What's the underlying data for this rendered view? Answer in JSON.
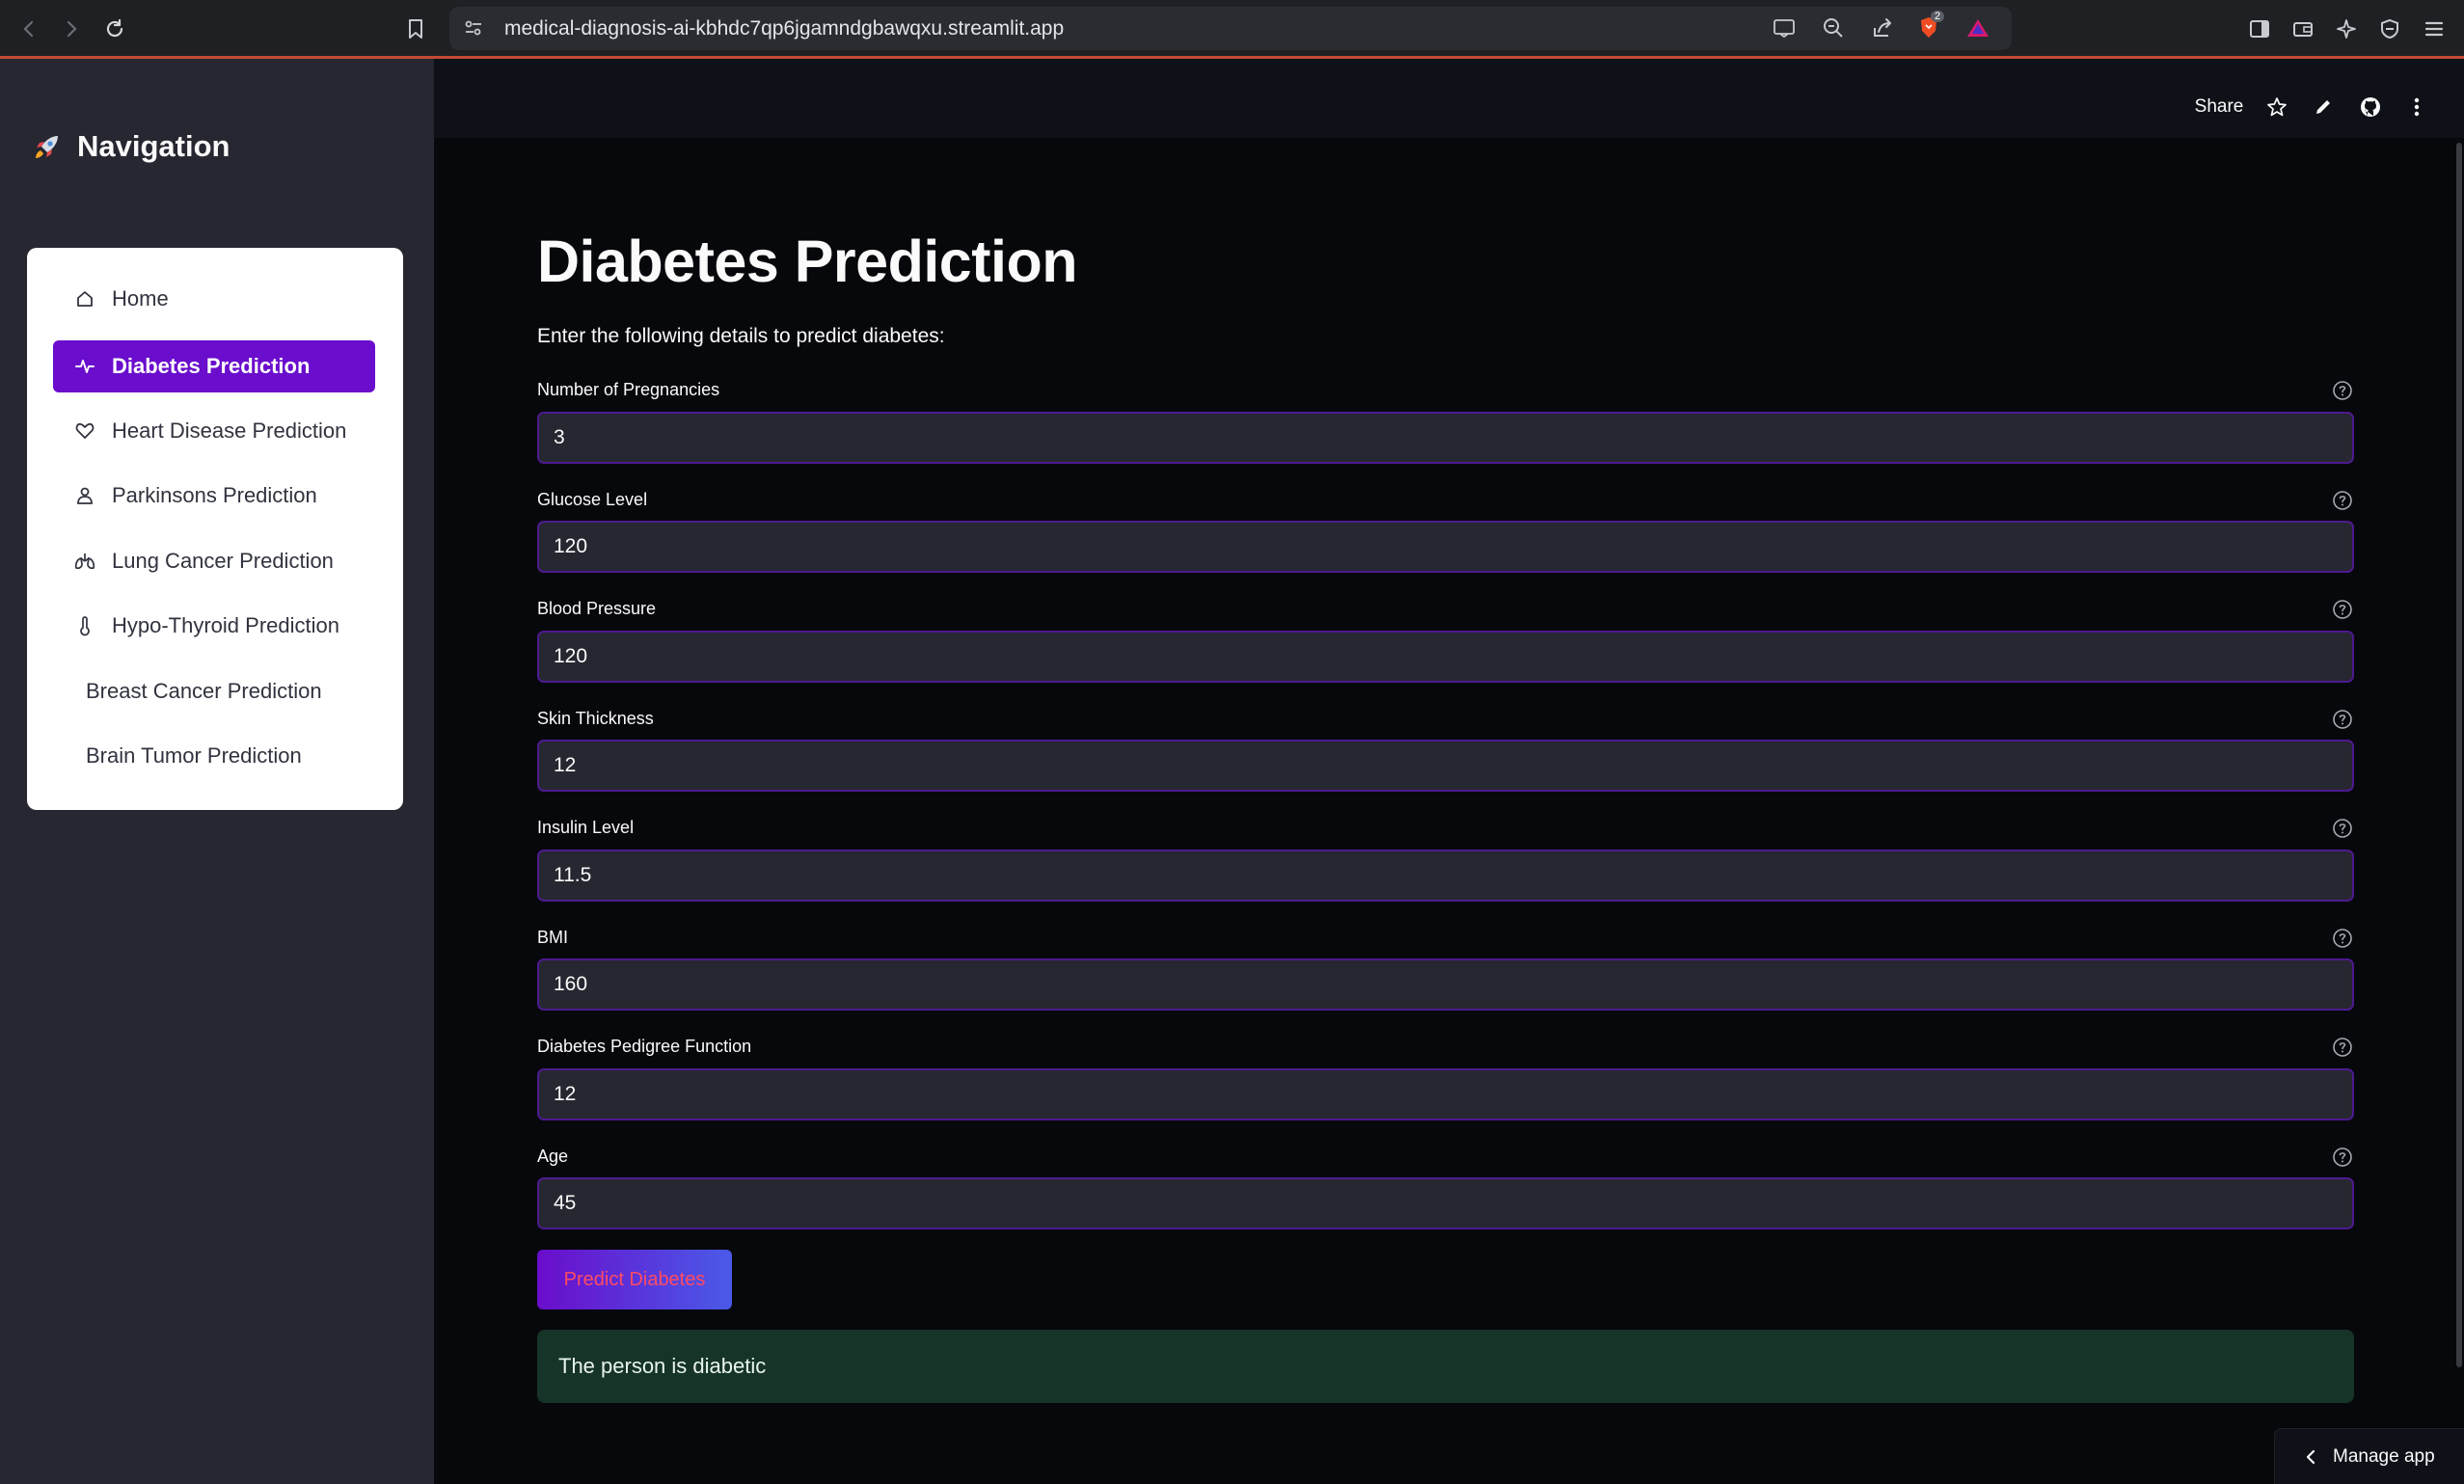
{
  "browser": {
    "url": "medical-diagnosis-ai-kbhdc7qp6jgamndgbawqxu.streamlit.app",
    "shields_badge": "2"
  },
  "sidebar": {
    "heading": "Navigation",
    "items": [
      {
        "label": "Home",
        "icon": "home-icon",
        "active": false
      },
      {
        "label": "Diabetes Prediction",
        "icon": "activity-icon",
        "active": true
      },
      {
        "label": "Heart Disease Prediction",
        "icon": "heart-icon",
        "active": false
      },
      {
        "label": "Parkinsons Prediction",
        "icon": "person-icon",
        "active": false
      },
      {
        "label": "Lung Cancer Prediction",
        "icon": "lungs-icon",
        "active": false
      },
      {
        "label": "Hypo-Thyroid Prediction",
        "icon": "thermometer-icon",
        "active": false
      },
      {
        "label": "Breast Cancer Prediction",
        "icon": "",
        "active": false
      },
      {
        "label": "Brain Tumor Prediction",
        "icon": "",
        "active": false
      }
    ]
  },
  "header": {
    "share_label": "Share"
  },
  "main": {
    "title": "Diabetes Prediction",
    "description": "Enter the following details to predict diabetes:",
    "fields": [
      {
        "label": "Number of Pregnancies",
        "value": "3"
      },
      {
        "label": "Glucose Level",
        "value": "120"
      },
      {
        "label": "Blood Pressure",
        "value": "120"
      },
      {
        "label": "Skin Thickness",
        "value": "12"
      },
      {
        "label": "Insulin Level",
        "value": "11.5"
      },
      {
        "label": "BMI",
        "value": "160"
      },
      {
        "label": "Diabetes Pedigree Function",
        "value": "12"
      },
      {
        "label": "Age",
        "value": "45"
      }
    ],
    "predict_button": "Predict Diabetes",
    "result": "The person is diabetic"
  },
  "footer": {
    "manage_app": "Manage app"
  },
  "colors": {
    "accent": "#6a0dcc",
    "sidebar_bg": "#262730",
    "main_bg": "#07080c",
    "success_bg": "#173428",
    "button_text": "#ff4b62"
  }
}
